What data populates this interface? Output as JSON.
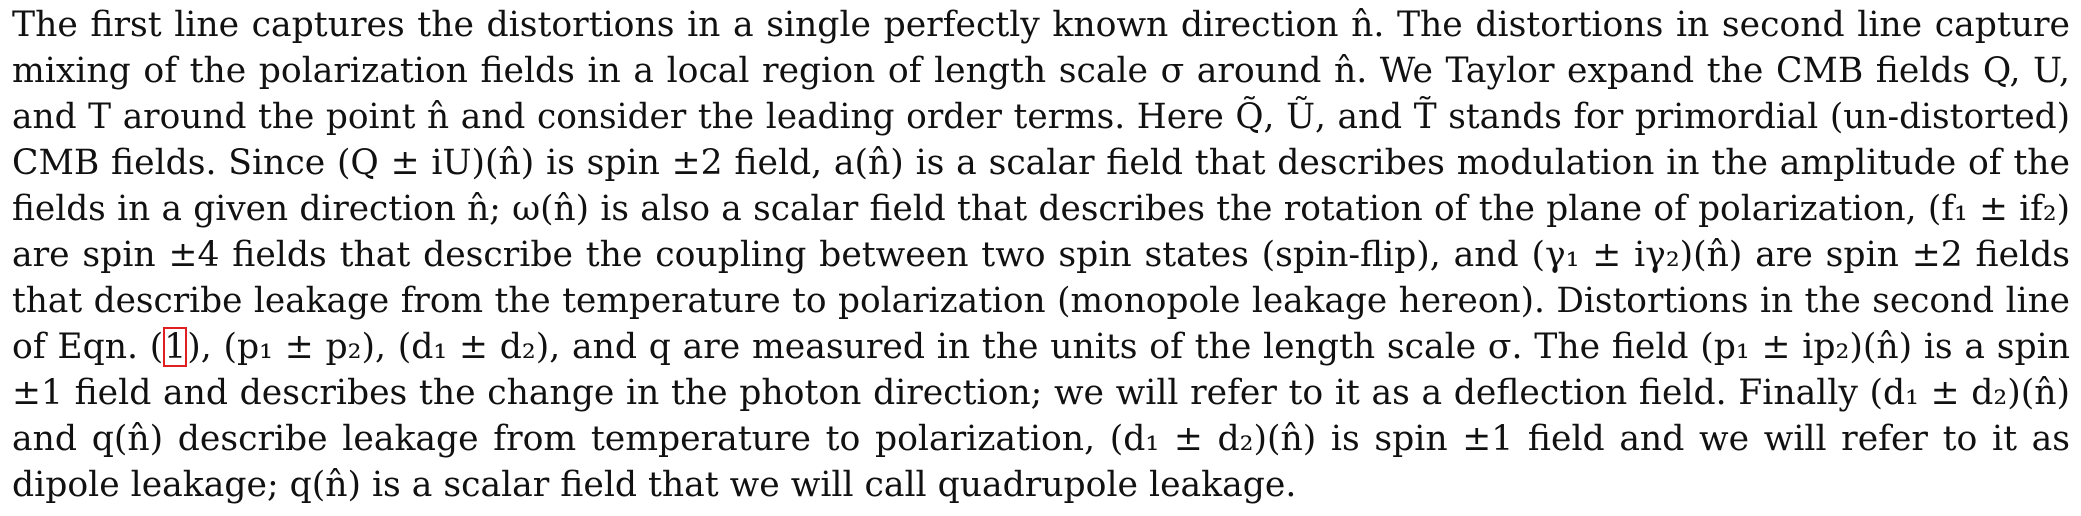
{
  "paragraph": {
    "lines": [
      "The first line captures the distortions in a single perfectly known direction n̂. The distortions in second line capture",
      "mixing of the polarization fields in a local region of length scale σ around n̂. We Taylor expand the CMB fields Q, U,",
      "and T around the point n̂ and consider the leading order terms. Here Q̃, Ũ, and T̃ stands for primordial (un-distorted)",
      "CMB fields. Since (Q ± iU)(n̂) is spin ±2 field, a(n̂) is a scalar field that describes modulation in the amplitude of the",
      "fields in a given direction n̂; ω(n̂) is also a scalar field that describes the rotation of the plane of polarization, (f₁ ± if₂)",
      "are spin ±4 fields that describe the coupling between two spin states (spin-flip), and (γ₁ ± iγ₂)(n̂) are spin ±2 fields",
      "that describe leakage from the temperature to polarization (monopole leakage hereon). Distortions in the second line",
      "of Eqn. (1), (p₁ ± p₂), (d₁ ± d₂), and q are measured in the units of the length scale σ. The field (p₁ ± ip₂)(n̂) is a spin",
      "±1 field and describes the change in the photon direction; we will refer to it as a deflection field. Finally (d₁ ± d₂)(n̂)",
      "and q(n̂) describe leakage from temperature to polarization, (d₁ ± d₂)(n̂) is spin ±1 field and we will refer to it as",
      "dipole leakage; q(n̂) is a scalar field that we will call quadrupole leakage."
    ],
    "line8": {
      "before": "of Eqn. (",
      "ref": "1",
      "after": "), (p₁ ± p₂), (d₁ ± d₂), and q are measured in the units of the length scale σ. The field (p₁ ± ip₂)(n̂) is a spin"
    }
  }
}
